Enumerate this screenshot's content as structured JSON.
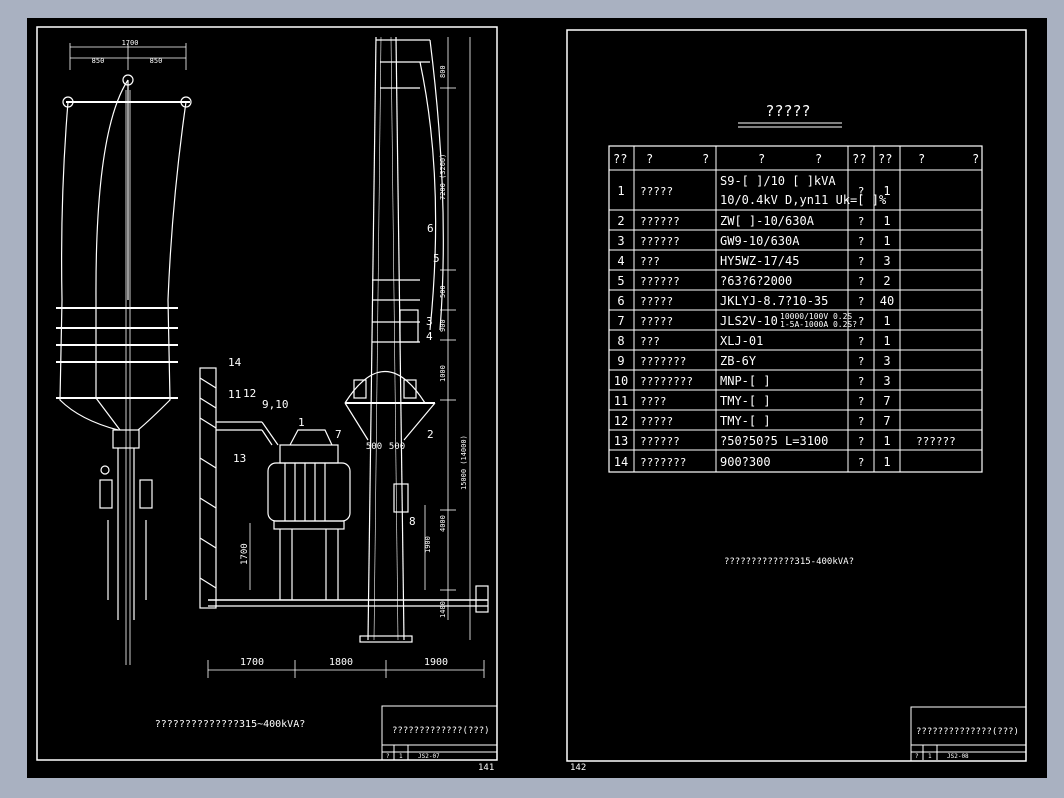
{
  "left_sheet": {
    "caption": "??????????????315~400kVA?",
    "title_block": {
      "title": "?????????????(???)",
      "cell_a": "?",
      "cell_b": "1",
      "code": "JS2-07"
    },
    "page_number": "141",
    "dims": {
      "top_total": "1700",
      "top_half_left": "850",
      "top_half_right": "850",
      "bottom_a": "1700",
      "bottom_b": "1800",
      "bottom_c": "1900",
      "pole_dim_1": "7200 (3200)",
      "pole_dim_2": "800",
      "pole_dim_3": "500",
      "pole_dim_4": "900",
      "pole_dim_5": "1000",
      "pole_dim_6": "15000 (14000)",
      "pole_dim_7": "4000",
      "pole_dim_8": "1900",
      "pole_dim_9": "1400",
      "transformer_height": "1700",
      "platform_left": "500",
      "platform_right": "500"
    },
    "callouts": [
      "1",
      "2",
      "3",
      "4",
      "5",
      "6",
      "7",
      "8",
      "9,10",
      "11",
      "12",
      "13",
      "14"
    ]
  },
  "right_sheet": {
    "heading": "?????",
    "caption": "?????????????315-400kVA?",
    "title_block": {
      "title": "??????????????(???)",
      "cell_a": "?",
      "cell_b": "1",
      "code": "JS2-08"
    },
    "page_number": "142",
    "table": {
      "headers": [
        "??",
        "?",
        "?",
        "?",
        "?",
        "??",
        "??",
        "?",
        "?"
      ],
      "rows": [
        {
          "no": "1",
          "name": "?????",
          "spec": [
            "S9-[ ]/10 [ ]kVA",
            "10/0.4kV  D,yn11  Uk=[ ]%"
          ],
          "unit": "?",
          "qty": "1",
          "note": ""
        },
        {
          "no": "2",
          "name": "??????",
          "spec": [
            "ZW[ ]-10/630A"
          ],
          "unit": "?",
          "qty": "1",
          "note": ""
        },
        {
          "no": "3",
          "name": "??????",
          "spec": [
            "GW9-10/630A"
          ],
          "unit": "?",
          "qty": "1",
          "note": ""
        },
        {
          "no": "4",
          "name": "???",
          "spec": [
            "HY5WZ-17/45"
          ],
          "unit": "?",
          "qty": "3",
          "note": ""
        },
        {
          "no": "5",
          "name": "??????",
          "spec": [
            "?63?6?2000"
          ],
          "unit": "?",
          "qty": "2",
          "note": ""
        },
        {
          "no": "6",
          "name": "?????",
          "spec": [
            "JKLYJ-8.7?10-35"
          ],
          "unit": "?",
          "qty": "40",
          "note": ""
        },
        {
          "no": "7",
          "name": "?????",
          "spec": [
            "JLS2V-10"
          ],
          "spec_small": [
            "10000/100V  0.2S",
            "1-5A-1000A  0.2S?"
          ],
          "unit": "?",
          "qty": "1",
          "note": ""
        },
        {
          "no": "8",
          "name": "???",
          "spec": [
            "XLJ-01"
          ],
          "unit": "?",
          "qty": "1",
          "note": ""
        },
        {
          "no": "9",
          "name": "???????",
          "spec": [
            "ZB-6Y"
          ],
          "unit": "?",
          "qty": "3",
          "note": ""
        },
        {
          "no": "10",
          "name": "????????",
          "spec": [
            "MNP-[ ]"
          ],
          "unit": "?",
          "qty": "3",
          "note": ""
        },
        {
          "no": "11",
          "name": "????",
          "spec": [
            "TMY-[ ]"
          ],
          "unit": "?",
          "qty": "7",
          "note": ""
        },
        {
          "no": "12",
          "name": "?????",
          "spec": [
            "TMY-[ ]"
          ],
          "unit": "?",
          "qty": "7",
          "note": ""
        },
        {
          "no": "13",
          "name": "??????",
          "spec": [
            "?50?50?5   L=3100"
          ],
          "unit": "?",
          "qty": "1",
          "note": "??????"
        },
        {
          "no": "14",
          "name": "???????",
          "spec": [
            "900?300"
          ],
          "unit": "?",
          "qty": "1",
          "note": ""
        }
      ]
    }
  },
  "colors": {
    "background": "#000000",
    "frame": "#a9b1c1",
    "lines": "#ffffff"
  }
}
